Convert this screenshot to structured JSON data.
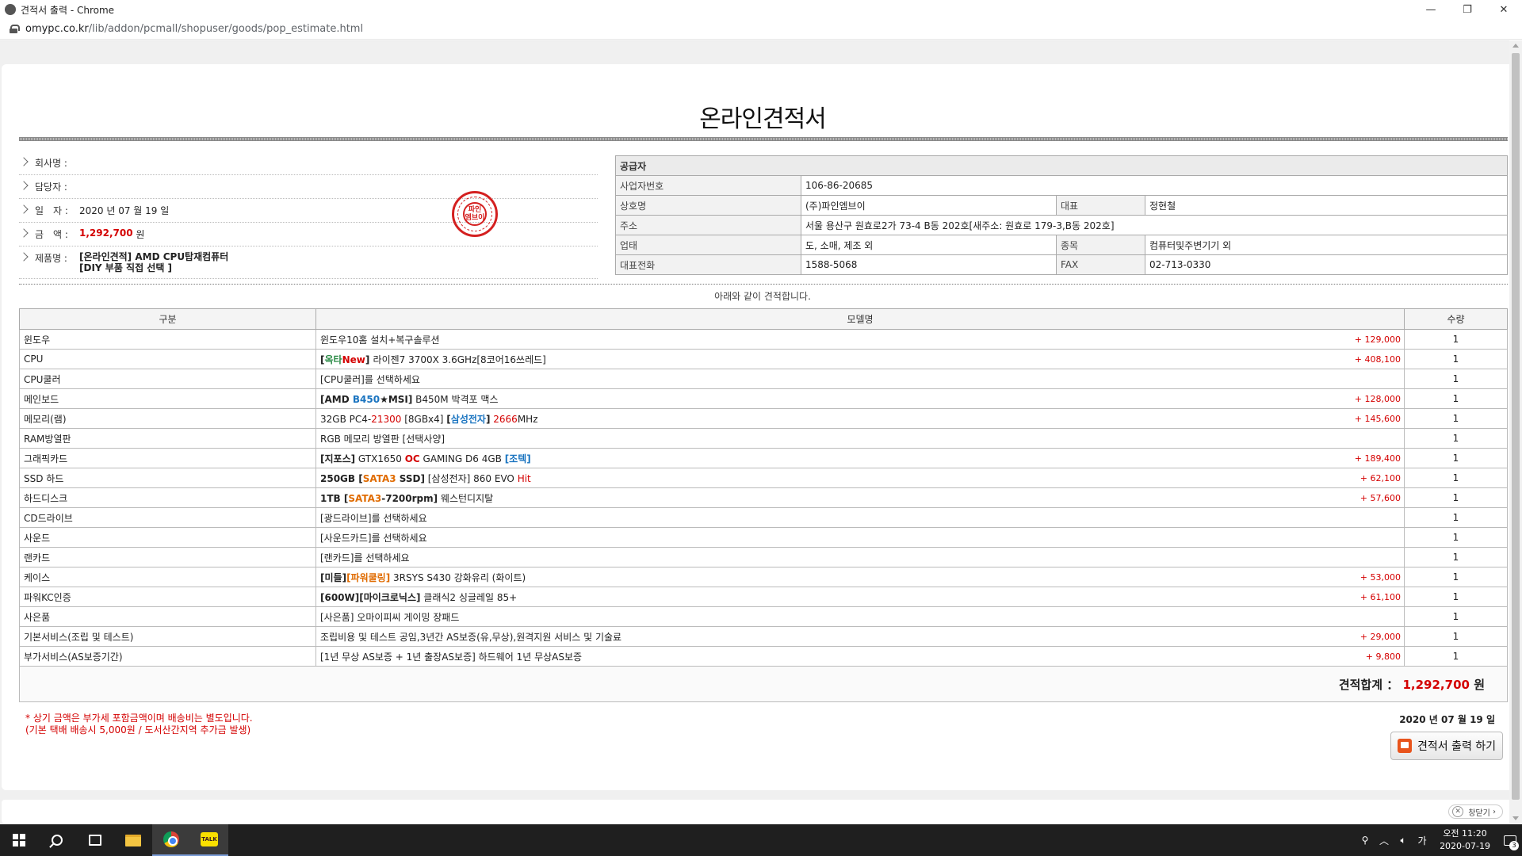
{
  "window": {
    "title": "견적서 출력 - Chrome",
    "url_host": "omypc.co.kr",
    "url_path": "/lib/addon/pcmall/shopuser/goods/pop_estimate.html"
  },
  "doc": {
    "title": "온라인견적서",
    "below_text": "아래와 같이 견적합니다."
  },
  "customer": {
    "company_label": "회사명 :",
    "company": "",
    "manager_label": "담당자 :",
    "manager": "",
    "date_label": "일　자 :",
    "date": "2020 년 07 월 19 일",
    "amount_label": "금　액 :",
    "amount": "1,292,700",
    "amount_unit": "원",
    "product_label": "제품명 :",
    "product_line1": "[온라인견적] AMD CPU탑재컴퓨터",
    "product_line2": "[DIY 부품 직접 선택 ]"
  },
  "seal_text": "파인 엠브이",
  "supplier": {
    "header": "공급자",
    "biz_no_label": "사업자번호",
    "biz_no": "106-86-20685",
    "name_label": "상호명",
    "name": "(주)파인엠브이",
    "ceo_label": "대표",
    "ceo": "정현철",
    "addr_label": "주소",
    "addr": "서울 용산구 원효로2가 73-4 B동 202호[새주소: 원효로 179-3,B동 202호]",
    "type_label": "업태",
    "type": "도, 소매, 제조 외",
    "item_label": "종목",
    "item": "컴퓨터및주변기기 외",
    "tel_label": "대표전화",
    "tel": "1588-5068",
    "fax_label": "FAX",
    "fax": "02-713-0330"
  },
  "table": {
    "headers": [
      "구분",
      "모델명",
      "수량"
    ],
    "rows": [
      {
        "cat": "윈도우",
        "price": "129,000",
        "qty": "1"
      },
      {
        "cat": "CPU",
        "price": "408,100",
        "qty": "1"
      },
      {
        "cat": "CPU쿨러",
        "price": "",
        "qty": "1"
      },
      {
        "cat": "메인보드",
        "price": "128,000",
        "qty": "1"
      },
      {
        "cat": "메모리(램)",
        "price": "145,600",
        "qty": "1"
      },
      {
        "cat": "RAM방열판",
        "price": "",
        "qty": "1"
      },
      {
        "cat": "그래픽카드",
        "price": "189,400",
        "qty": "1"
      },
      {
        "cat": "SSD 하드",
        "price": "62,100",
        "qty": "1"
      },
      {
        "cat": "하드디스크",
        "price": "57,600",
        "qty": "1"
      },
      {
        "cat": "CD드라이브",
        "price": "",
        "qty": "1"
      },
      {
        "cat": "사운드",
        "price": "",
        "qty": "1"
      },
      {
        "cat": "랜카드",
        "price": "",
        "qty": "1"
      },
      {
        "cat": "케이스",
        "price": "53,000",
        "qty": "1"
      },
      {
        "cat": "파워KC인증",
        "price": "61,100",
        "qty": "1"
      },
      {
        "cat": "사은품",
        "price": "",
        "qty": "1"
      },
      {
        "cat": "기본서비스(조립 및 테스트)",
        "price": "29,000",
        "qty": "1"
      },
      {
        "cat": "부가서비스(AS보증기간)",
        "price": "9,800",
        "qty": "1"
      }
    ],
    "models": {
      "m0": "윈도우10홈 설치+복구솔루션",
      "m1a": "[",
      "m1b": "옥타",
      "m1c": "New",
      "m1d": "] ",
      "m1e": "라이젠7 3700X 3.6GHz[8코어16쓰레드]",
      "m2": "[CPU쿨러]를 선택하세요",
      "m3a": "[AMD ",
      "m3b": "B450",
      "m3c": "★MSI]",
      "m3d": " B450M 박격포 맥스",
      "m4a": "32GB PC4-",
      "m4b": "21300",
      "m4c": " [8GBx4] ",
      "m4d": "[",
      "m4e": "삼성전자",
      "m4f": "]",
      "m4g": " ",
      "m4h": "2666",
      "m4i": "MHz",
      "m5": "RGB 메모리 방열판 [선택사양]",
      "m6a": "[지포스]",
      "m6b": " GTX1650 ",
      "m6c": "OC",
      "m6d": " GAMING D6 4GB ",
      "m6e": "[조텍]",
      "m7a": "250GB [",
      "m7b": "SATA3",
      "m7c": " SSD]",
      "m7d": " [삼성전자] 860 EVO ",
      "m7e": "Hit",
      "m8a": "1TB [",
      "m8b": "SATA3",
      "m8c": "-7200rpm]",
      "m8d": " 웨스턴디지탈",
      "m9": "[광드라이브]를 선택하세요",
      "m10": "[사운드카드]를 선택하세요",
      "m11": "[랜카드]를 선택하세요",
      "m12a": "[미들]",
      "m12b": "[파워쿨링]",
      "m12c": " 3RSYS S430 강화유리 (화이트)",
      "m13a": "[600W][마이크로닉스]",
      "m13b": " 클래식2 싱글레일 85+",
      "m14": "[사은품] 오마이피씨 게이밍 장패드",
      "m15": "조립비용 및 테스트 공임,3년간 AS보증(유,무상),원격지원 서비스 및 기술료",
      "m16": "[1년 무상 AS보증 + 1년 출장AS보증] 하드웨어 1년 무상AS보증"
    },
    "total_label": "견적합계 ：",
    "total_value": "1,292,700",
    "total_unit": "원"
  },
  "notes": {
    "line1": "* 상기 금액은 부가세 포함금액이며 배송비는 별도입니다.",
    "line2": "(기본 택배 배송시 5,000원 / 도서산간지역 추가금 발생)",
    "date": "2020 년 07 월 19 일"
  },
  "print_label": "견적서 출력 하기",
  "close_label": "창닫기",
  "taskbar": {
    "kakao": "TALK",
    "ime": "가",
    "time": "오전 11:20",
    "date": "2020-07-19",
    "notif_count": "3"
  },
  "colors": {
    "accent_red": "#d40000",
    "accent_blue": "#1a74c0",
    "accent_orange": "#e06b00"
  }
}
